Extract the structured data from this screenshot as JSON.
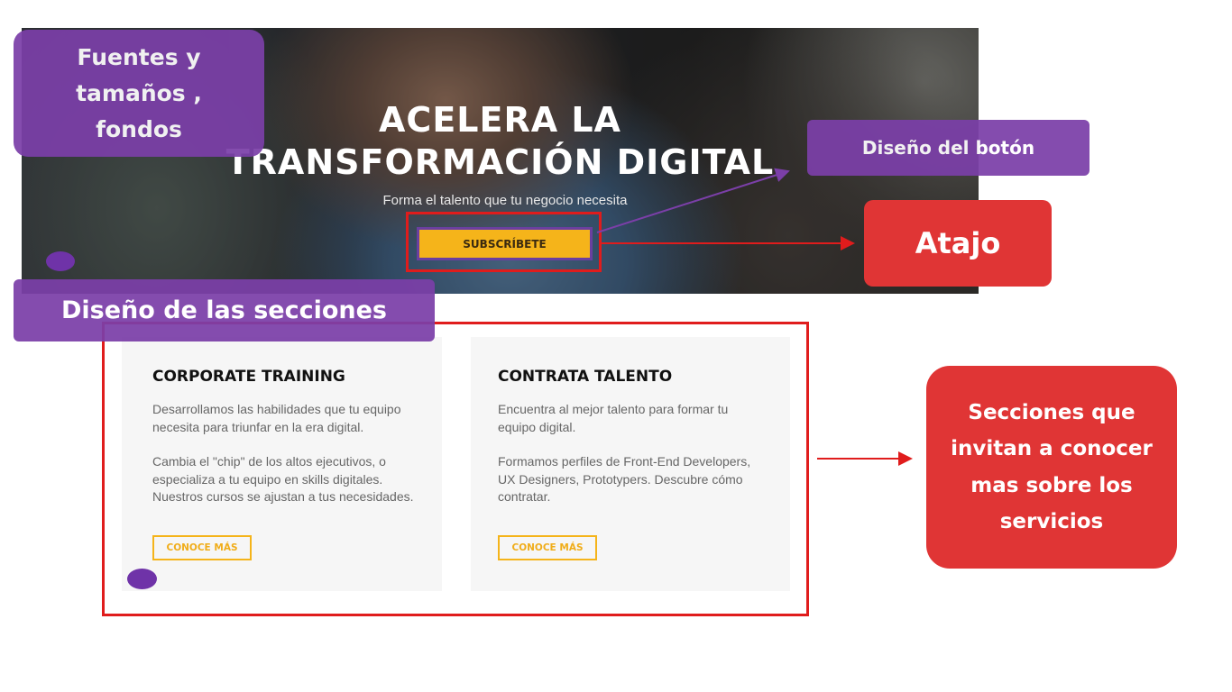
{
  "hero": {
    "title_line1": "ACELERA LA",
    "title_line2": "TRANSFORMACIÓN DIGITAL",
    "subtitle": "Forma el talento que tu negocio necesita",
    "cta_label": "SUBSCRÍBETE"
  },
  "cards": [
    {
      "title": "CORPORATE TRAINING",
      "paragraph1": "Desarrollamos las habilidades que tu equipo necesita para triunfar en la era digital.",
      "paragraph2": "Cambia el \"chip\" de los altos ejecutivos, o especializa a tu equipo en skills digitales. Nuestros cursos se ajustan a tus necesidades.",
      "button_label": "CONOCE MÁS"
    },
    {
      "title": "CONTRATA TALENTO",
      "paragraph1": "Encuentra al mejor talento para formar tu equipo digital.",
      "paragraph2": "Formamos perfiles de Front-End Developers, UX Designers, Prototypers. Descubre cómo contratar.",
      "button_label": "CONOCE MÁS"
    }
  ],
  "annotations": {
    "fonts": "Fuentes y tamaños , fondos",
    "button_design": "Diseño del botón",
    "shortcut": "Atajo",
    "sections_design": "Diseño de las secciones",
    "sections_invite": "Secciones que invitan a conocer mas sobre los servicios"
  },
  "colors": {
    "accent_yellow": "#f5b41a",
    "annotation_purple": "#7b3fa8",
    "annotation_red": "#e03535",
    "frame_red": "#e01c1c"
  }
}
